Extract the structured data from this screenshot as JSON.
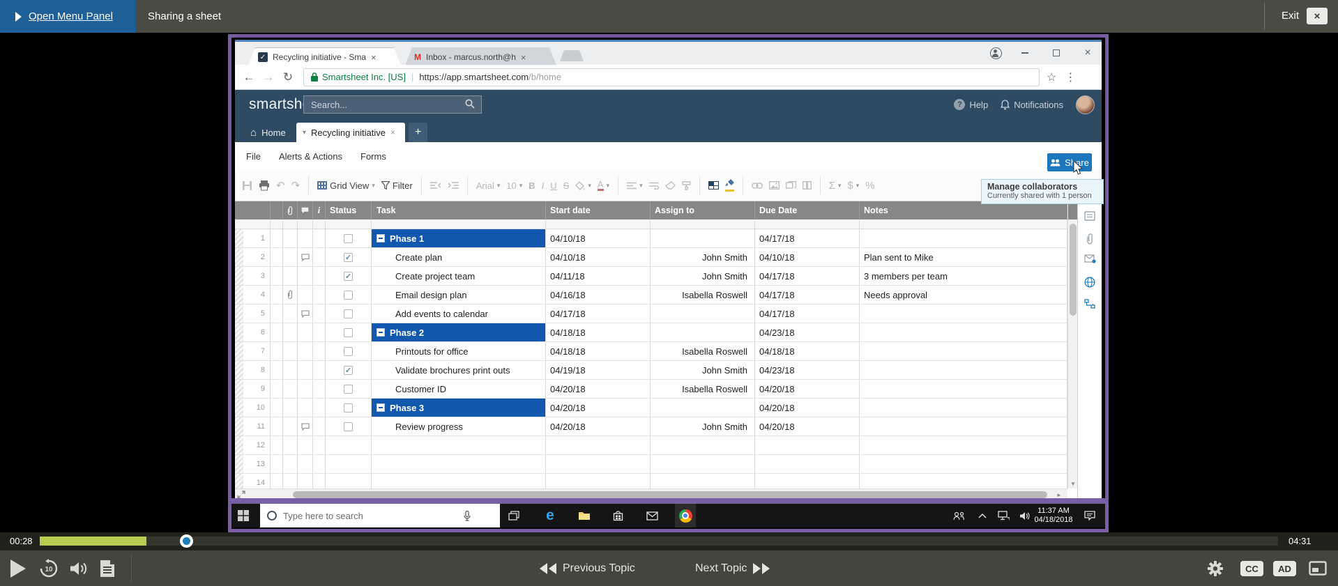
{
  "topbar": {
    "menu_button": "Open Menu Panel",
    "topic_title": "Sharing a sheet",
    "exit_label": "Exit"
  },
  "browser": {
    "tabs": [
      {
        "title": "Recycling initiative - Sma"
      },
      {
        "title": "Inbox - marcus.north@h"
      }
    ],
    "security_label": "Smartsheet Inc. [US]",
    "url_host": "https://app.smartsheet.com",
    "url_path": "/b/home"
  },
  "smartsheet": {
    "logo": "smartsheet",
    "search_placeholder": "Search...",
    "help_label": "Help",
    "notifications_label": "Notifications",
    "home_tab": "Home",
    "sheet_tab": "Recycling initiative",
    "menus": [
      "File",
      "Alerts & Actions",
      "Forms"
    ],
    "toolbar": {
      "view_label": "Grid View",
      "filter_label": "Filter",
      "font_name": "Arial",
      "font_size": "10"
    },
    "share_label": "Share",
    "tooltip": {
      "title": "Manage collaborators",
      "subtitle": "Currently shared with 1 person"
    },
    "grid": {
      "columns": [
        "Status",
        "Task",
        "Start date",
        "Assign to",
        "Due Date",
        "Notes"
      ],
      "rows": [
        {
          "num": "1",
          "kind": "phase",
          "collapse": true,
          "check": "",
          "task": "Phase 1",
          "start": "04/10/18",
          "assign": "",
          "due": "04/17/18",
          "notes": ""
        },
        {
          "num": "2",
          "kind": "task",
          "comment": true,
          "check": "✓",
          "task": "Create plan",
          "start": "04/10/18",
          "assign": "John Smith",
          "due": "04/10/18",
          "notes": "Plan sent to Mike"
        },
        {
          "num": "3",
          "kind": "task",
          "check": "✓",
          "task": "Create project team",
          "start": "04/11/18",
          "assign": "John Smith",
          "due": "04/17/18",
          "notes": "3 members per team"
        },
        {
          "num": "4",
          "kind": "task",
          "attach": true,
          "check": "",
          "task": "Email design plan",
          "start": "04/16/18",
          "assign": "Isabella Roswell",
          "due": "04/17/18",
          "notes": "Needs approval"
        },
        {
          "num": "5",
          "kind": "task",
          "comment": true,
          "check": "",
          "task": "Add events to calendar",
          "start": "04/17/18",
          "assign": "",
          "due": "04/17/18",
          "notes": ""
        },
        {
          "num": "6",
          "kind": "phase",
          "collapse": true,
          "check": "",
          "task": "Phase 2",
          "start": "04/18/18",
          "assign": "",
          "due": "04/23/18",
          "notes": ""
        },
        {
          "num": "7",
          "kind": "task",
          "check": "",
          "task": "Printouts for office",
          "start": "04/18/18",
          "assign": "Isabella Roswell",
          "due": "04/18/18",
          "notes": ""
        },
        {
          "num": "8",
          "kind": "task",
          "check": "✓",
          "task": "Validate brochures print outs",
          "start": "04/19/18",
          "assign": "John Smith",
          "due": "04/23/18",
          "notes": ""
        },
        {
          "num": "9",
          "kind": "task",
          "check": "",
          "task": "Customer ID",
          "start": "04/20/18",
          "assign": "Isabella Roswell",
          "due": "04/20/18",
          "notes": ""
        },
        {
          "num": "10",
          "kind": "phase",
          "collapse": true,
          "check": "",
          "task": "Phase 3",
          "start": "04/20/18",
          "assign": "",
          "due": "04/20/18",
          "notes": ""
        },
        {
          "num": "11",
          "kind": "task",
          "comment": true,
          "check": "",
          "task": "Review progress",
          "start": "04/20/18",
          "assign": "John Smith",
          "due": "04/20/18",
          "notes": ""
        },
        {
          "num": "12",
          "kind": "empty",
          "check": "",
          "task": "",
          "start": "",
          "assign": "",
          "due": "",
          "notes": ""
        },
        {
          "num": "13",
          "kind": "empty",
          "check": "",
          "task": "",
          "start": "",
          "assign": "",
          "due": "",
          "notes": ""
        },
        {
          "num": "14",
          "kind": "empty",
          "check": "",
          "task": "",
          "start": "",
          "assign": "",
          "due": "",
          "notes": ""
        }
      ]
    }
  },
  "taskbar": {
    "search_placeholder": "Type here to search",
    "time": "11:37 AM",
    "date": "04/18/2018"
  },
  "player": {
    "current_time": "00:28",
    "total_time": "04:31",
    "progress_percent": 9,
    "prev_label": "Previous Topic",
    "next_label": "Next Topic",
    "cc_label": "CC",
    "ad_label": "AD"
  },
  "colors": {
    "frame_purple": "#7a5ea6",
    "progress_green": "#b8cc52",
    "phase_blue": "#1158ae",
    "share_blue": "#1b76bb",
    "header_navy": "#2f4a63"
  },
  "glyphs": {
    "caret_down": "▾",
    "star": "☆",
    "menu_dots": "⋮",
    "back_arrow": "←",
    "forward_arrow": "→",
    "reload": "↻",
    "undo": "↶",
    "redo": "↷",
    "bold": "B",
    "italic": "I",
    "underline": "U",
    "strikethrough": "S",
    "sum": "Σ",
    "dollar": "$",
    "percent": "%",
    "font_color": "A",
    "plus": "+",
    "close": "×",
    "home": "⌂",
    "scroll_up": "▲",
    "scroll_down": "▼",
    "scroll_right": "►",
    "info": "i",
    "question": "?"
  }
}
